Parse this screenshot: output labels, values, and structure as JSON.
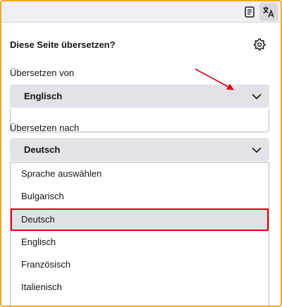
{
  "toolbar": {
    "reader_icon": "reader-view-icon",
    "translate_icon": "translate-icon"
  },
  "panel": {
    "title": "Diese Seite übersetzen?",
    "settings_icon": "gear-icon",
    "from": {
      "label": "Übersetzen von",
      "selected": "Englisch"
    },
    "to": {
      "label": "Übersetzen nach",
      "selected": "Deutsch"
    },
    "options": [
      {
        "label": "Sprache auswählen",
        "selected": false
      },
      {
        "label": "Bulgarisch",
        "selected": false
      },
      {
        "label": "Deutsch",
        "selected": true
      },
      {
        "label": "Englisch",
        "selected": false
      },
      {
        "label": "Französisch",
        "selected": false
      },
      {
        "label": "Italienisch",
        "selected": false
      }
    ]
  },
  "colors": {
    "frame": "#f5a623",
    "highlight": "#e0000f",
    "select_bg": "#e3e2e8",
    "annotation_arrow": "#e0000f"
  }
}
